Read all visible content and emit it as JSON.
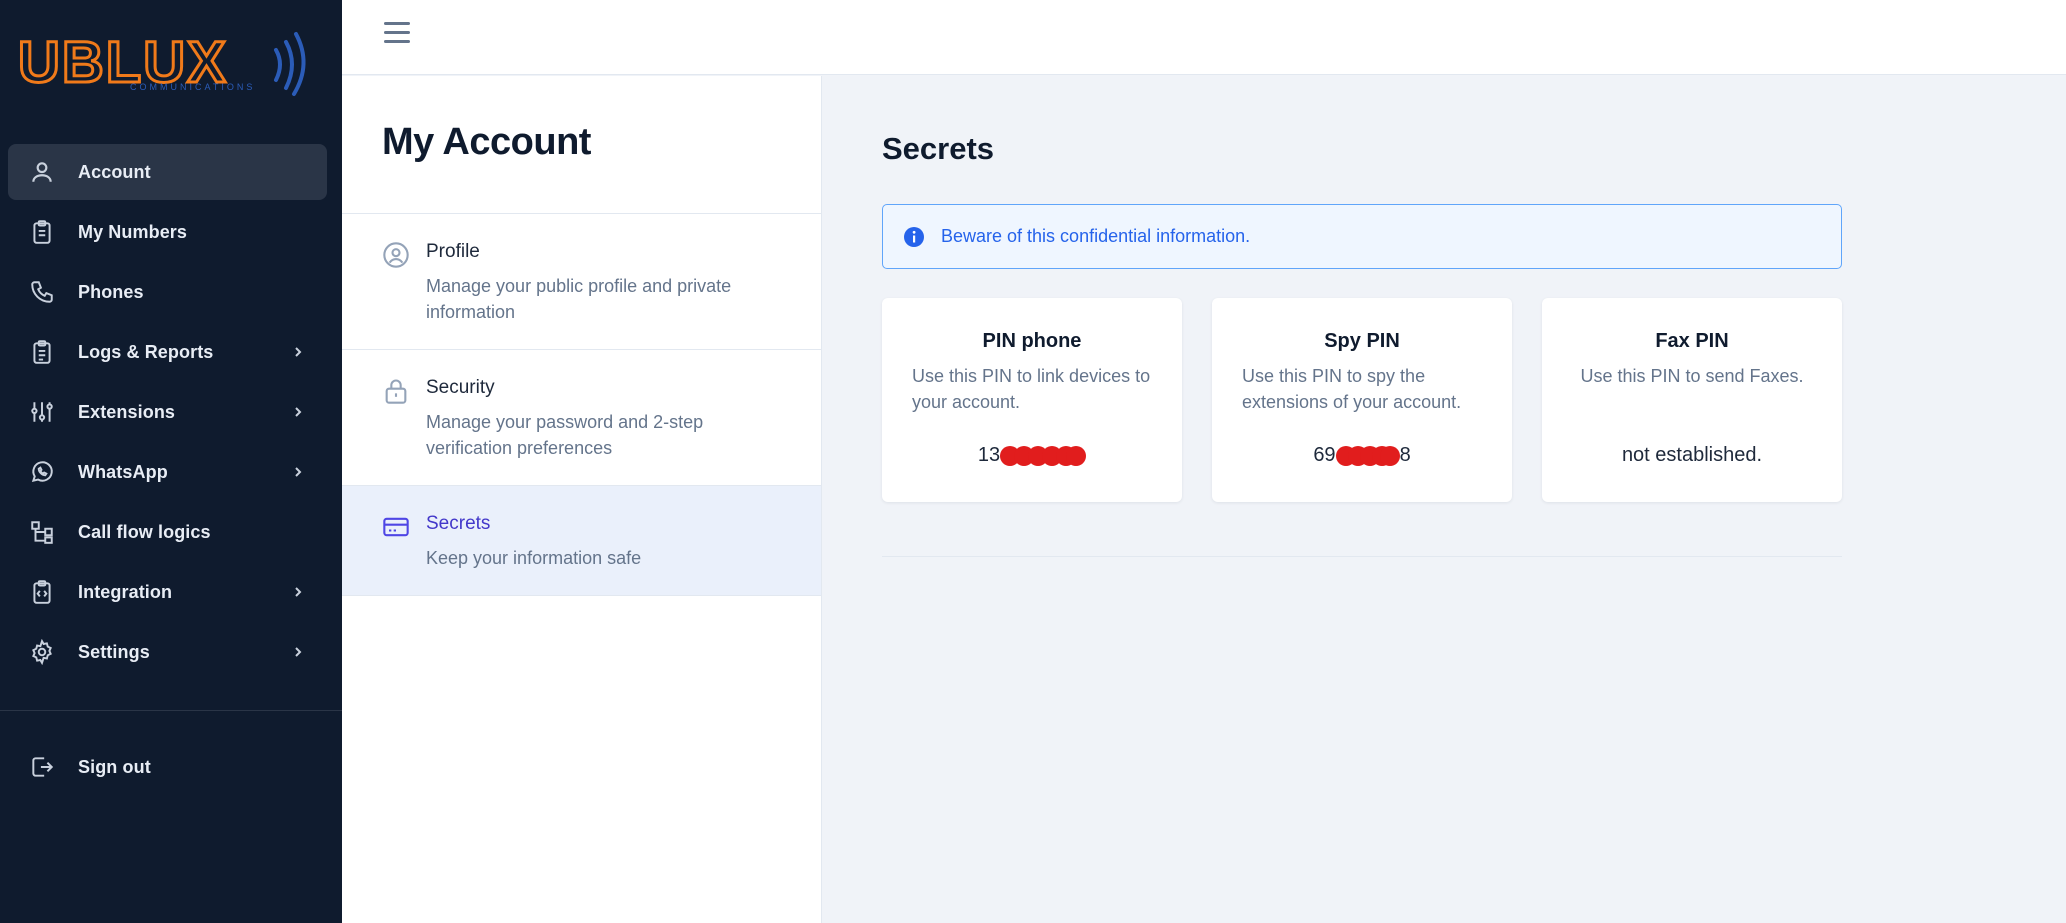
{
  "logo": {
    "wordmark": "UBLUX",
    "tagline": "COMMUNICATIONS"
  },
  "sidebar": {
    "items": [
      {
        "label": "Account",
        "icon": "user-icon",
        "active": true,
        "has_submenu": false
      },
      {
        "label": "My Numbers",
        "icon": "clipboard-icon",
        "active": false,
        "has_submenu": false
      },
      {
        "label": "Phones",
        "icon": "phone-icon",
        "active": false,
        "has_submenu": false
      },
      {
        "label": "Logs & Reports",
        "icon": "clipboard-list-icon",
        "active": false,
        "has_submenu": true
      },
      {
        "label": "Extensions",
        "icon": "sliders-icon",
        "active": false,
        "has_submenu": true
      },
      {
        "label": "WhatsApp",
        "icon": "whatsapp-icon",
        "active": false,
        "has_submenu": true
      },
      {
        "label": "Call flow logics",
        "icon": "flow-icon",
        "active": false,
        "has_submenu": false
      },
      {
        "label": "Integration",
        "icon": "code-clipboard-icon",
        "active": false,
        "has_submenu": true
      },
      {
        "label": "Settings",
        "icon": "gear-icon",
        "active": false,
        "has_submenu": true
      }
    ],
    "signout_label": "Sign out"
  },
  "account": {
    "title": "My Account",
    "menu": [
      {
        "title": "Profile",
        "description": "Manage your public profile and private information",
        "icon": "user-circle-icon",
        "active": false
      },
      {
        "title": "Security",
        "description": "Manage your password and 2-step verification preferences",
        "icon": "lock-icon",
        "active": false
      },
      {
        "title": "Secrets",
        "description": "Keep your information safe",
        "icon": "credit-card-icon",
        "active": true
      }
    ]
  },
  "secrets": {
    "title": "Secrets",
    "alert": "Beware of this confidential information.",
    "cards": [
      {
        "title": "PIN phone",
        "description": "Use this PIN to link devices to your account.",
        "value_prefix": "13",
        "value_suffix": ""
      },
      {
        "title": "Spy PIN",
        "description": "Use this PIN to spy the extensions of your account.",
        "value_prefix": "69",
        "value_suffix": "8"
      },
      {
        "title": "Fax PIN",
        "description": "Use this PIN to send Faxes.",
        "value": "not established."
      }
    ]
  },
  "colors": {
    "sidebar_bg": "#0f1b2e",
    "active_nav_bg": "#2a3547",
    "logo_orange": "#f07a1a",
    "logo_blue": "#2b5cb8",
    "accent_indigo": "#4f46e5",
    "alert_blue": "#2563eb",
    "redaction_red": "#e11d1d"
  }
}
